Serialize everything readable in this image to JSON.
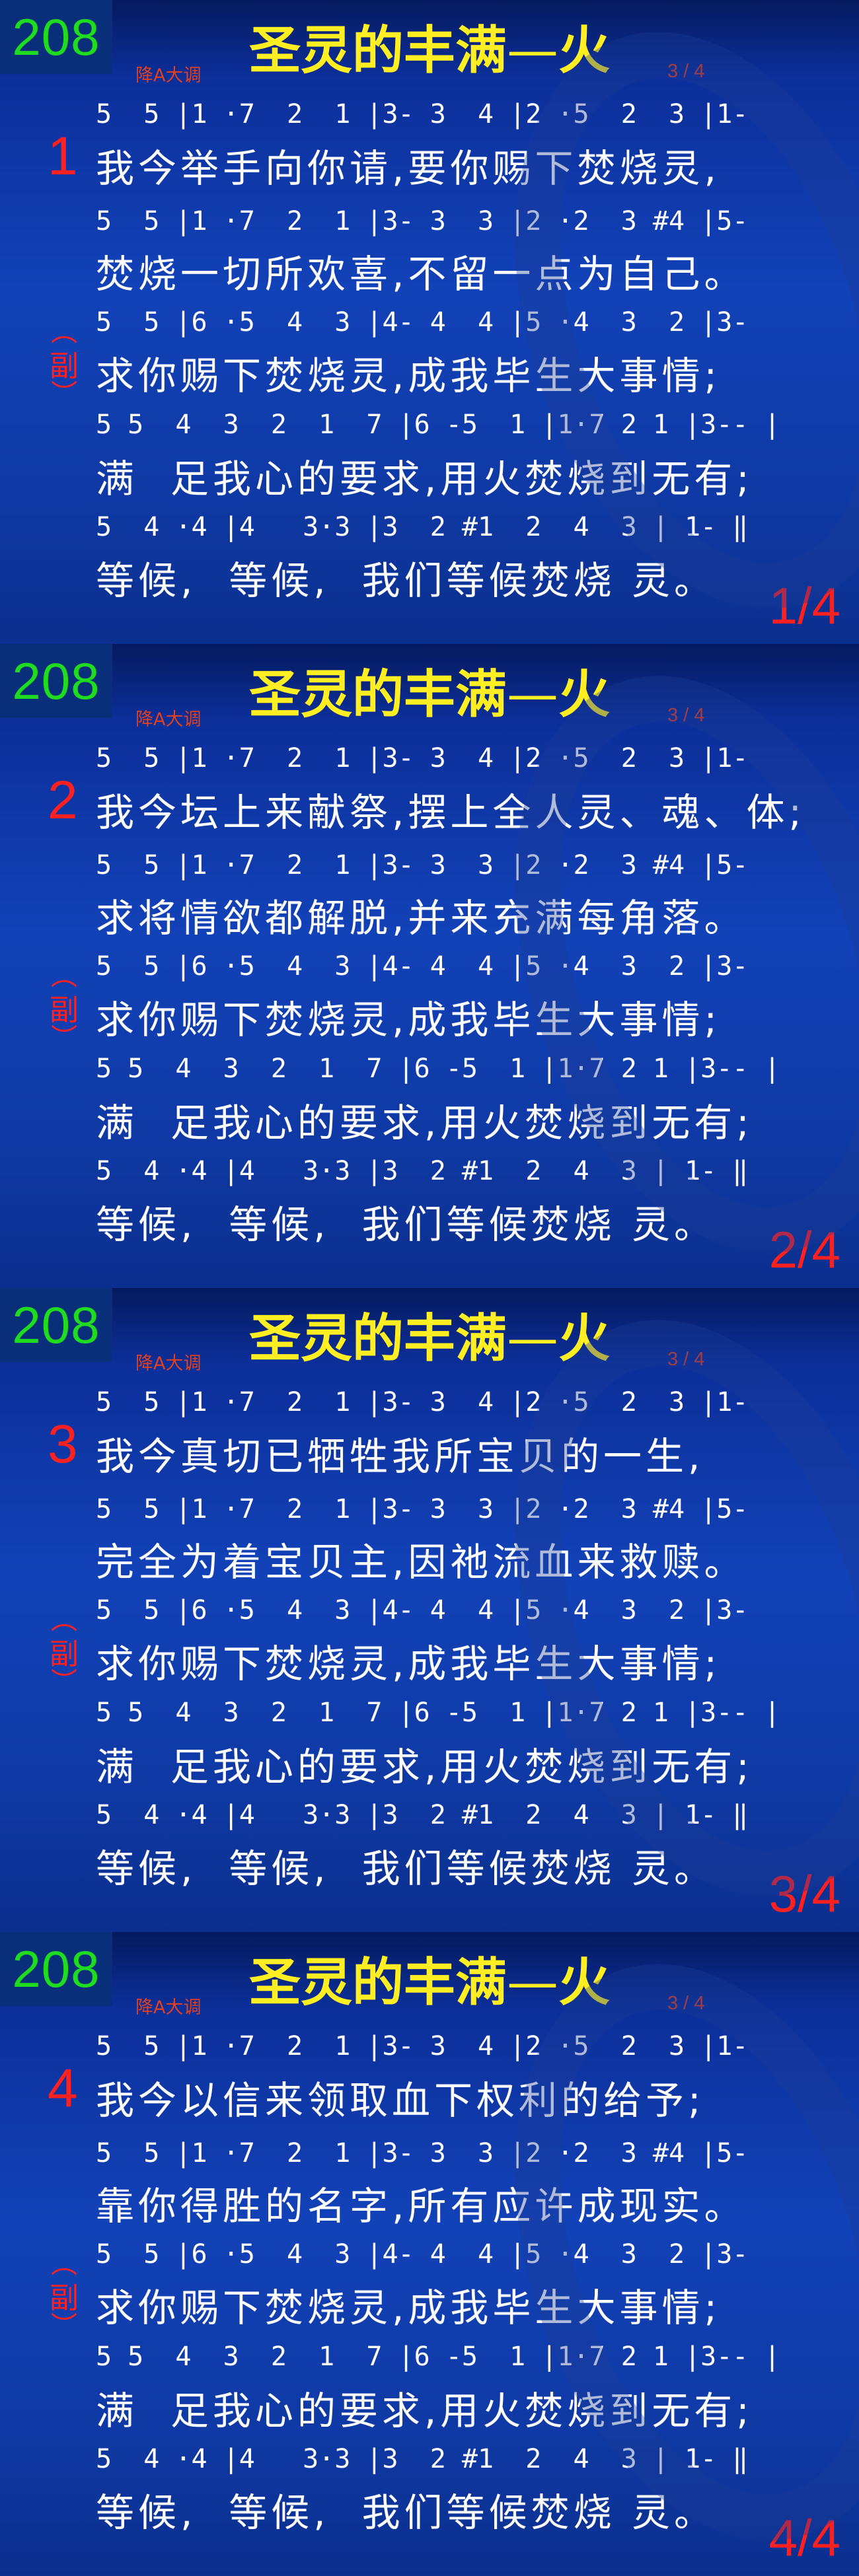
{
  "song": {
    "number": "208",
    "title": "圣灵的丰满",
    "title_suffix": "火",
    "key": "降A大调",
    "meter": "3 / 4",
    "chorus_label": "副"
  },
  "notation": [
    "5  5 |1 ·7  2  1 |3- 3  4 |2 ·5  2  3 |1-",
    "5  5 |1 ·7  2  1 |3- 3  3 |2 ·2  3 #4 |5-",
    "5  5 |6 ·5  4  3 |4- 4  4 |5 ·4  3  2 |3-",
    "5 5  4  3  2  1  7 |6 -5  1 |1·7 2 1 |3-- |",
    "5  4 ·4 |4   3·3 |3  2 #1  2  4  3 | 1- ‖"
  ],
  "slides": [
    {
      "verse": "1",
      "page": "1/4",
      "lines": [
        "我今举手向你请,要你赐下焚烧灵,",
        "焚烧一切所欢喜,不留一点为自己。",
        "求你赐下焚烧灵,成我毕生大事情;",
        "满  足我心的要求,用火焚烧到无有;",
        "等候,  等候,  我们等候焚烧 灵。"
      ]
    },
    {
      "verse": "2",
      "page": "2/4",
      "lines": [
        "我今坛上来献祭,摆上全人灵、魂、体;",
        "求将情欲都解脱,并来充满每角落。",
        "求你赐下焚烧灵,成我毕生大事情;",
        "满  足我心的要求,用火焚烧到无有;",
        "等候,  等候,  我们等候焚烧 灵。"
      ]
    },
    {
      "verse": "3",
      "page": "3/4",
      "lines": [
        "我今真切已牺牲我所宝贝的一生,",
        "完全为着宝贝主,因祂流血来救赎。",
        "求你赐下焚烧灵,成我毕生大事情;",
        "满  足我心的要求,用火焚烧到无有;",
        "等候,  等候,  我们等候焚烧 灵。"
      ]
    },
    {
      "verse": "4",
      "page": "4/4",
      "lines": [
        "我今以信来领取血下权利的给予;",
        "靠你得胜的名字,所有应许成现实。",
        "求你赐下焚烧灵,成我毕生大事情;",
        "满  足我心的要求,用火焚烧到无有;",
        "等候,  等候,  我们等候焚烧 灵。"
      ]
    }
  ]
}
